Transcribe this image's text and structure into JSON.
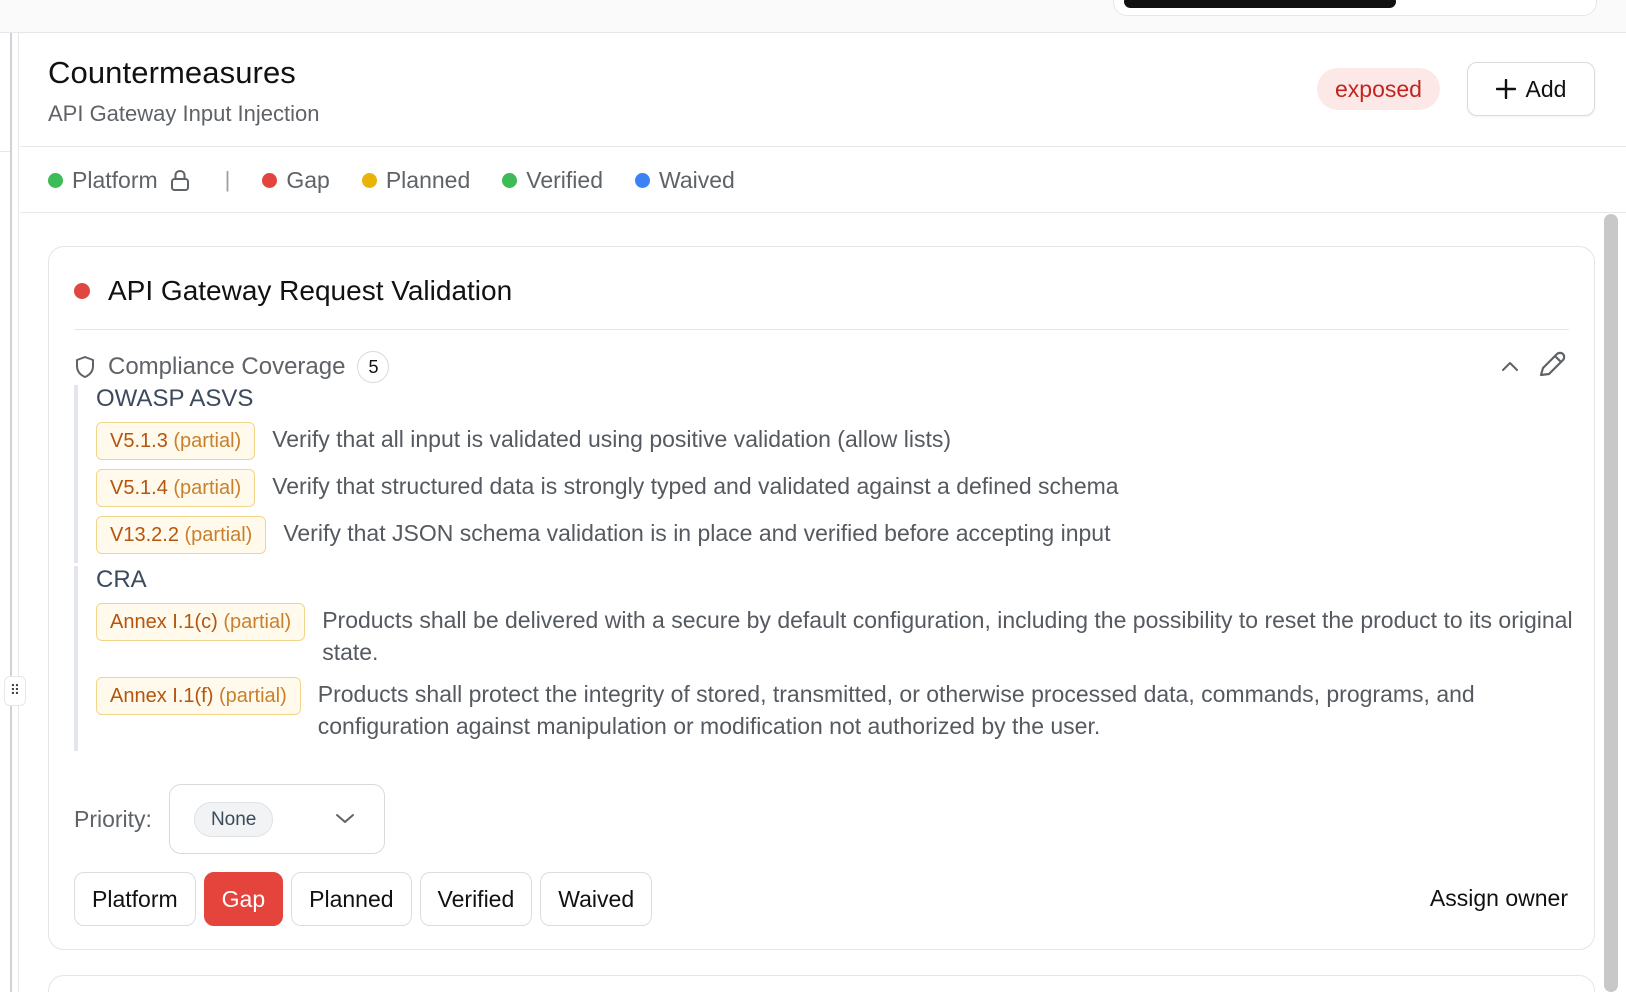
{
  "header": {
    "title": "Countermeasures",
    "subtitle": "API Gateway Input Injection",
    "status_badge": "exposed",
    "add_label": "Add"
  },
  "legend": {
    "items": [
      {
        "label": "Platform",
        "color": "#3dbb54",
        "locked": true
      },
      {
        "label": "Gap",
        "color": "#e5443c"
      },
      {
        "label": "Planned",
        "color": "#eab308"
      },
      {
        "label": "Verified",
        "color": "#3dbb54"
      },
      {
        "label": "Waived",
        "color": "#3b82f6"
      }
    ],
    "separator": "|"
  },
  "card": {
    "title": "API Gateway Request Validation",
    "status_color": "#e0473f",
    "coverage": {
      "label": "Compliance Coverage",
      "count": "5",
      "frameworks": [
        {
          "name": "OWASP ASVS",
          "requirements": [
            {
              "id": "V5.1.3",
              "level": "(partial)",
              "text": "Verify that all input is validated using positive validation (allow lists)"
            },
            {
              "id": "V5.1.4",
              "level": "(partial)",
              "text": "Verify that structured data is strongly typed and validated against a defined schema"
            },
            {
              "id": "V13.2.2",
              "level": "(partial)",
              "text": "Verify that JSON schema validation is in place and verified before accepting input"
            }
          ]
        },
        {
          "name": "CRA",
          "requirements": [
            {
              "id": "Annex I.1(c)",
              "level": "(partial)",
              "text": "Products shall be delivered with a secure by default configuration, including the possibility to reset the product to its original state."
            },
            {
              "id": "Annex I.1(f)",
              "level": "(partial)",
              "text": "Products shall protect the integrity of stored, transmitted, or otherwise processed data, commands, programs, and configuration against manipulation or modification not authorized by the user."
            }
          ]
        }
      ]
    },
    "priority": {
      "label": "Priority:",
      "value": "None"
    },
    "status_buttons": [
      {
        "label": "Platform",
        "active": false
      },
      {
        "label": "Gap",
        "active": true
      },
      {
        "label": "Planned",
        "active": false
      },
      {
        "label": "Verified",
        "active": false
      },
      {
        "label": "Waived",
        "active": false
      }
    ],
    "assign_owner": "Assign owner"
  }
}
